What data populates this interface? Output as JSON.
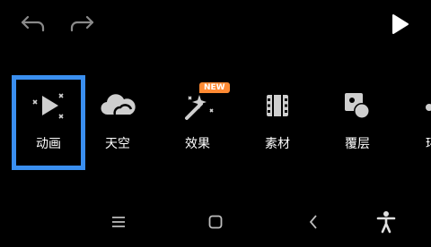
{
  "toolbar": {
    "tools": [
      {
        "label": "动画",
        "icon": "play-sparkle-icon",
        "selected": true
      },
      {
        "label": "天空",
        "icon": "cloud-icon"
      },
      {
        "label": "效果",
        "icon": "magic-wand-icon",
        "badge": "NEW"
      },
      {
        "label": "素材",
        "icon": "film-icon"
      },
      {
        "label": "覆层",
        "icon": "overlay-shapes-icon"
      },
      {
        "label": "环",
        "icon": "more-icon"
      }
    ]
  },
  "colors": {
    "background": "#000000",
    "selection": "#3a8ff0",
    "badge": "#ff8a33",
    "icon": "#cfcfcf"
  }
}
